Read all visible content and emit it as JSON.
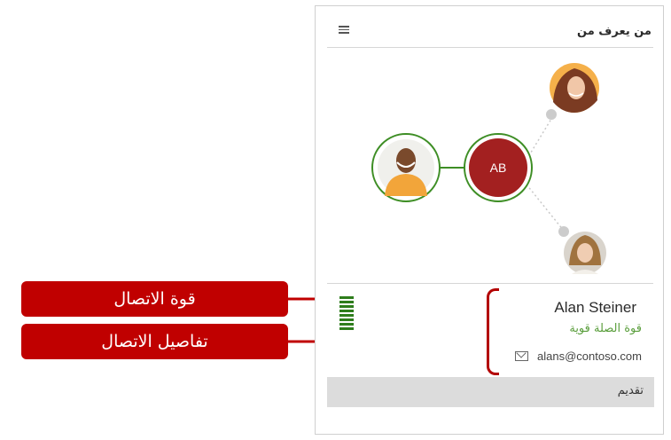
{
  "panel": {
    "title": "من يعرف من",
    "icons": {
      "menu": "list-menu-icon",
      "mail": "mail-icon"
    },
    "graph": {
      "center_initials": "AB",
      "center_color": "#a32020",
      "ring_color": "#3e8e25",
      "people": [
        "person-photo-man",
        "person-photo-woman-1",
        "person-photo-woman-2"
      ]
    },
    "contact": {
      "name": "Alan Steiner",
      "relation": "قوة الصلة قوية",
      "email": "alans@contoso.com"
    },
    "strength_level": 8,
    "footer_label": "تقديم"
  },
  "callouts": {
    "strength": "قوة الاتصال",
    "details": "تفاصيل الاتصال",
    "color": "#c00000"
  }
}
